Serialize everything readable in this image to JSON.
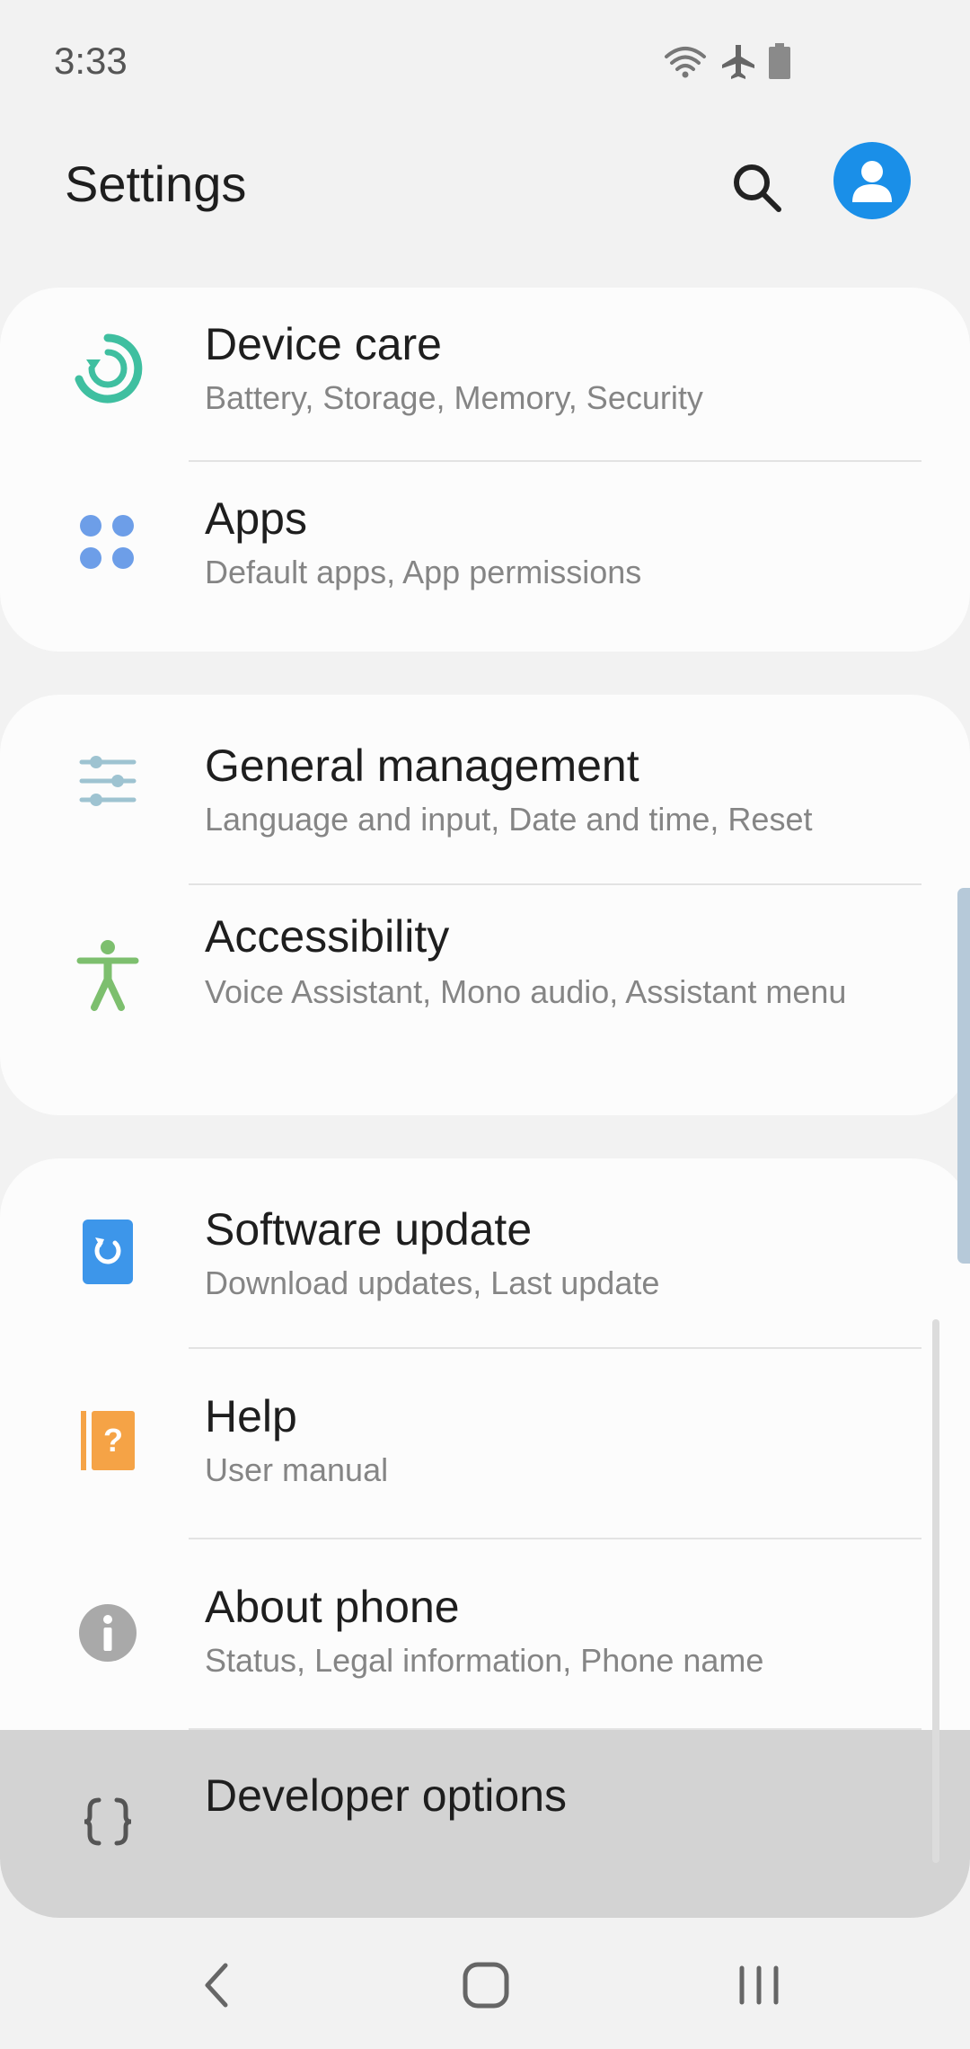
{
  "status_bar": {
    "time": "3:33",
    "icons": [
      "wifi-icon",
      "airplane-icon",
      "battery-icon"
    ]
  },
  "header": {
    "title": "Settings",
    "search_icon": "search-icon",
    "avatar_icon": "account-icon",
    "accent_color": "#1a8fe8"
  },
  "items": [
    {
      "title": "Device care",
      "subtitle": "Battery, Storage, Memory, Security",
      "icon": "device-care-icon",
      "color": "#3fbfa0"
    },
    {
      "title": "Apps",
      "subtitle": "Default apps, App permissions",
      "icon": "apps-icon",
      "color": "#6d9ee8"
    },
    {
      "title": "General management",
      "subtitle": "Language and input, Date and time, Reset",
      "icon": "sliders-icon",
      "color": "#9ec3d1"
    },
    {
      "title": "Accessibility",
      "subtitle": "Voice Assistant, Mono audio, Assistant menu",
      "icon": "accessibility-icon",
      "color": "#7dbf6e"
    },
    {
      "title": "Software update",
      "subtitle": "Download updates, Last update",
      "icon": "software-update-icon",
      "color": "#3d96ea"
    },
    {
      "title": "Help",
      "subtitle": "User manual",
      "icon": "help-icon",
      "color": "#f5a346"
    },
    {
      "title": "About phone",
      "subtitle": "Status, Legal information, Phone name",
      "icon": "info-icon",
      "color": "#9e9e9e"
    },
    {
      "title": "Developer options",
      "subtitle": "",
      "icon": "developer-braces-icon",
      "color": "#555555"
    }
  ],
  "nav": {
    "back_icon": "back-icon",
    "home_icon": "home-icon",
    "recents_icon": "recents-icon"
  }
}
